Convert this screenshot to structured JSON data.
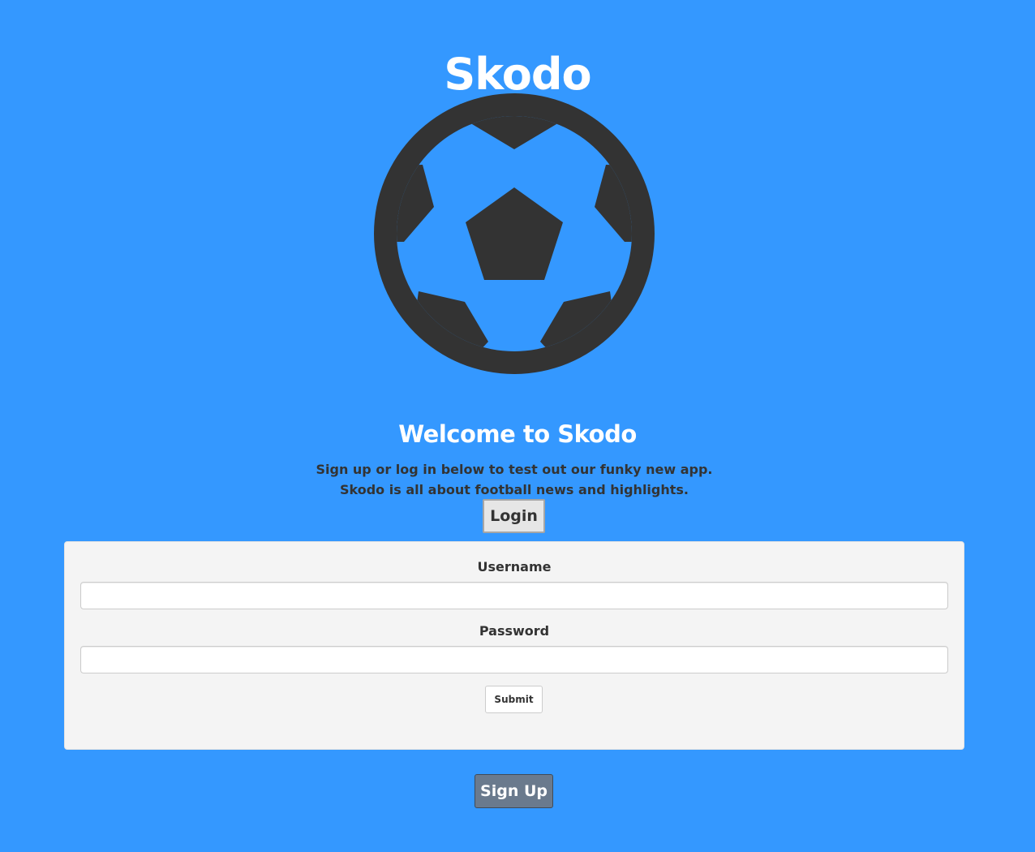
{
  "app": {
    "title": "Skodo",
    "logo_icon": "soccer-ball-icon"
  },
  "colors": {
    "background": "#3498ff",
    "heading_text": "#ffffff",
    "body_text": "#333333",
    "logo": "#333333",
    "panel_background": "#f4f4f4",
    "signup_button": "#6a7a8d"
  },
  "hero": {
    "welcome_heading": "Welcome to Skodo",
    "intro_text": "Sign up or log in below to test out our funky new app. Skodo is all about football news and highlights."
  },
  "login": {
    "toggle_label": "Login",
    "username_label": "Username",
    "username_value": "",
    "password_label": "Password",
    "password_value": "",
    "submit_label": "Submit"
  },
  "signup": {
    "button_label": "Sign Up"
  }
}
